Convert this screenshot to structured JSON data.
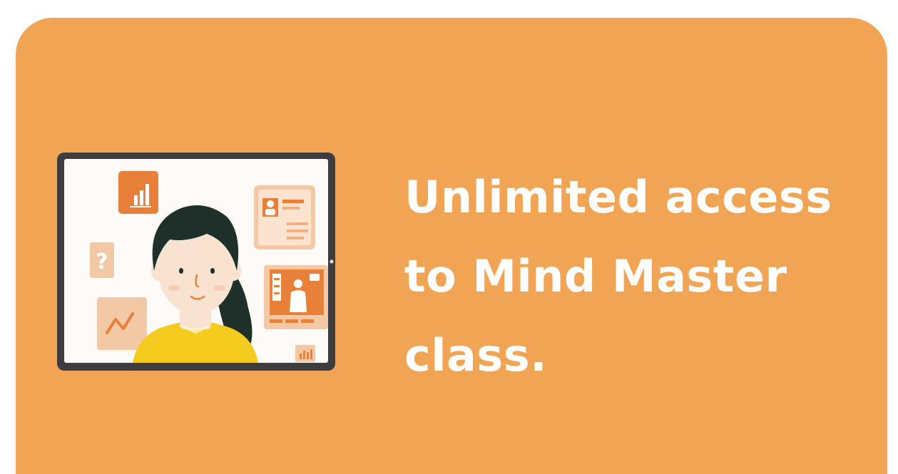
{
  "promo": {
    "headline": "Unlimited access\nto Mind Master\nclass."
  },
  "colors": {
    "card_background": "#f2a455",
    "text": "#ffffff",
    "tablet_frame": "#3d3d3f",
    "hair": "#1f2f2a",
    "shirt": "#f6cb1f",
    "accent": "#e9803a",
    "accent_light": "#f3c9a5"
  }
}
